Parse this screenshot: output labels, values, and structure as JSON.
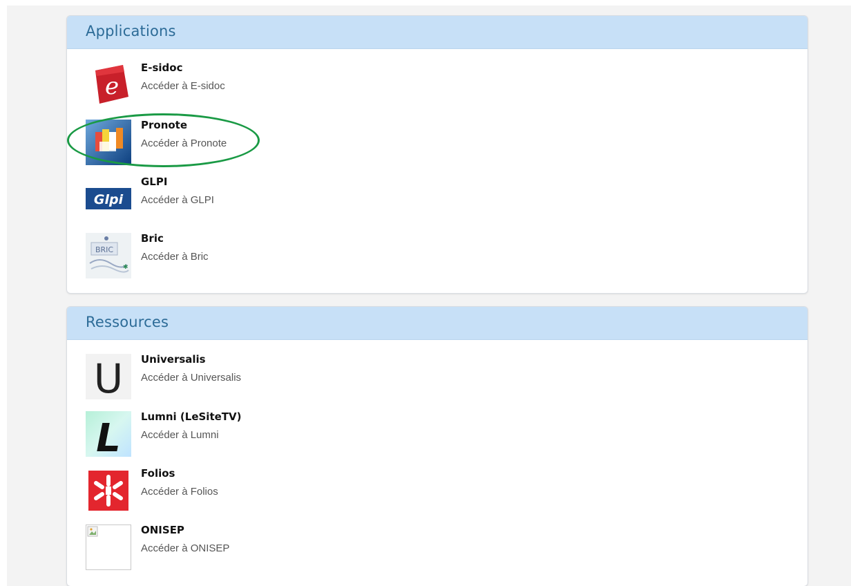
{
  "sections": [
    {
      "title": "Applications",
      "items": [
        {
          "name": "E-sidoc",
          "subtitle": "Accéder à E-sidoc",
          "icon": "esidoc-logo-icon"
        },
        {
          "name": "Pronote",
          "subtitle": "Accéder à Pronote",
          "icon": "pronote-logo-icon"
        },
        {
          "name": "GLPI",
          "subtitle": "Accéder à GLPI",
          "icon": "glpi-logo-icon",
          "logo_text": "Glpi"
        },
        {
          "name": "Bric",
          "subtitle": "Accéder à Bric",
          "icon": "bric-logo-icon",
          "logo_text": "BRIC"
        }
      ]
    },
    {
      "title": "Ressources",
      "items": [
        {
          "name": "Universalis",
          "subtitle": "Accéder à Universalis",
          "icon": "universalis-logo-icon",
          "logo_text": "U"
        },
        {
          "name": "Lumni (LeSiteTV)",
          "subtitle": "Accéder à Lumni",
          "icon": "lumni-logo-icon",
          "logo_text": "L"
        },
        {
          "name": "Folios",
          "subtitle": "Accéder à Folios",
          "icon": "folios-logo-icon"
        },
        {
          "name": "ONISEP",
          "subtitle": "Accéder à ONISEP",
          "icon": "broken-image-icon"
        }
      ]
    }
  ],
  "colors": {
    "header_bg": "#c7e0f7",
    "header_text": "#2c6b97",
    "highlight": "#1a9a45",
    "page_bg": "#f3f3f3"
  }
}
